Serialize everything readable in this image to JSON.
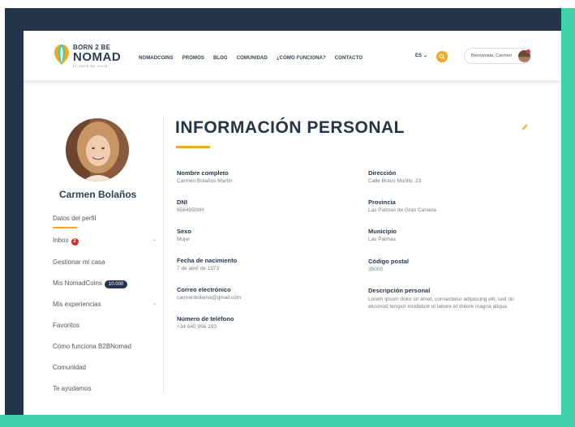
{
  "header": {
    "logo": {
      "line1": "BORN 2 BE",
      "line2": "NOMAD",
      "tagline": "EL ARTE DE VIVIR"
    },
    "nav": [
      "NOMADCOINS",
      "PROMOS",
      "BLOG",
      "COMUNIDAD",
      "¿CÓMO FUNCIONA?",
      "CONTACTO"
    ],
    "language": "ES",
    "user_greeting": "Bienvenida, Carmen"
  },
  "sidebar": {
    "name": "Carmen Bolaños",
    "items": [
      {
        "label": "Datos del perfil"
      },
      {
        "label": "Inbox",
        "badge": "2"
      },
      {
        "label": "Gestionar mi casa"
      },
      {
        "label": "Mis NomadCoins",
        "badge": "10.000"
      },
      {
        "label": "Mis experiencias"
      },
      {
        "label": "Favoritos"
      },
      {
        "label": "Cómo funciona B2BNomad"
      },
      {
        "label": "Comunidad"
      },
      {
        "label": "Te ayudamos"
      }
    ]
  },
  "main": {
    "title": "INFORMACIÓN PERSONAL",
    "left_fields": [
      {
        "label": "Nombre completo",
        "value": "Carmen Bolaños Martín"
      },
      {
        "label": "DNI",
        "value": "65849508H"
      },
      {
        "label": "Sexo",
        "value": "Mujer"
      },
      {
        "label": "Fecha de nacimiento",
        "value": "7 de abril de 1973"
      },
      {
        "label": "Correo electrónico",
        "value": "carmenbolama@gmail.com"
      },
      {
        "label": "Número de teléfono",
        "value": "+34 640 956 293"
      }
    ],
    "right_fields": [
      {
        "label": "Dirección",
        "value": "Calle Bravo Murillo, 23"
      },
      {
        "label": "Provincia",
        "value": "Las Palmas de Gran Canaria"
      },
      {
        "label": "Municipio",
        "value": "Las Palmas"
      },
      {
        "label": "Código postal",
        "value": "35000"
      },
      {
        "label": "Descripción personal",
        "value": "Lorem ipsum dolor sit amet, consectetur adipiscing elit, sed do eiusmod tempor incididunt ut labore et dolore magna aliqua."
      }
    ]
  },
  "colors": {
    "navy": "#24354a",
    "accent_orange": "#f5a623",
    "teal": "#3fd1a8",
    "badge_red": "#d62828"
  }
}
